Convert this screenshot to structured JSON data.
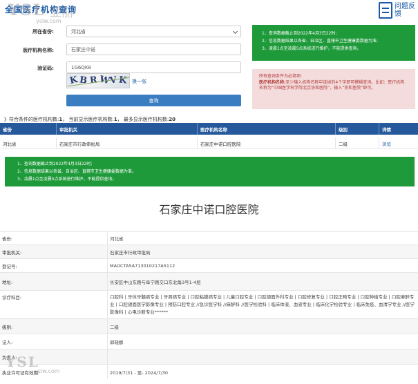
{
  "header": {
    "site_title": "全国医疗机构查询",
    "feedback_label": "问题反馈",
    "watermark_logo": "YSL",
    "watermark_cn": "亚丽",
    "watermark_url": "yslw.com"
  },
  "form": {
    "province_label": "所在省份:",
    "province_value": "河北省",
    "org_label": "医疗机构名称:",
    "org_value": "石家庄中诺",
    "captcha_label": "验证码:",
    "captcha_value": "1G6QK8",
    "captcha_chars": [
      "K",
      "B",
      "R",
      "W",
      "V",
      "K"
    ],
    "refresh_link": "换一张",
    "query_button": "查询"
  },
  "notice_top": {
    "lines": [
      "1、查询数据截止到2022年4月3日22时;",
      "2、信息数据结果以各省、自治区、直辖市卫生健康委数据为准;",
      "3、凌晨1点至凌晨5点系统进行维护，不能提供查询。"
    ]
  },
  "notice_red": {
    "line1": "所有查询条件为必填项:",
    "line2_label": "医疗机构名称:",
    "line2_text": "至少输入机构名称中连续的4个字即可模糊查询。比如：医疗机构名称为“中国医学科学院北京协和医院”，输入“协和医院”即可。"
  },
  "summary": {
    "prefix": "》符合条件的医疗机构数:",
    "match_count": "1",
    "current_label": "， 当前显示医疗机构数:",
    "current_count": "1",
    "max_label": "， 最多显示医疗机构数:",
    "max_count": "20"
  },
  "table": {
    "headers": [
      "省份",
      "审批机关",
      "医疗机构名称",
      "级别",
      "详情"
    ],
    "rows": [
      {
        "province": "河北省",
        "authority": "石家庄市行政审批局",
        "name": "石家庄中诺口腔医院",
        "level": "二级",
        "detail": "浏览"
      }
    ]
  },
  "notice_bottom": {
    "lines": [
      "1、查询数据截止到2022年4月3日22时;",
      "2、信息数据结果以各省、自治区、直辖市卫生健康委数据为准。",
      "3、凌晨1点至凌晨5点系统进行维护，不能提供查询。"
    ]
  },
  "detail": {
    "title": "石家庄中诺口腔医院",
    "rows": [
      {
        "label": "省份:",
        "value": "河北省"
      },
      {
        "label": "审批机关:",
        "value": "石家庄市行政审批局"
      },
      {
        "label": "登记号:",
        "value": "MAOCTA5A713010217A5112"
      },
      {
        "label": "地址:",
        "value": "长安区中山东路与阜宁路交口东北角3号1-4层"
      },
      {
        "label": "诊疗科目:",
        "value": "口腔科 | 牙体牙髓病专业 | 牙周病专业 | 口腔粘膜病专业 | 儿童口腔专业 | 口腔颌面外科专业 | 口腔修复专业 | 口腔正畸专业 | 口腔种植专业 | 口腔麻醉专业 | 口腔颌面医学影像专业 | 预防口腔专业 //急诊医学科 //麻醉科 //医学检验科 | 临床体液、血液专业 | 临床化学检验专业 | 临床免疫、血清学专业 //医学影像科 | 心电诊断专业******"
      },
      {
        "label": "级别:",
        "value": "二级"
      },
      {
        "label": "法人:",
        "value": "郭晓娜"
      },
      {
        "label": "负责人:",
        "value": ""
      },
      {
        "label": "执业许可证有效期:",
        "value": "2019/7/31 - 至- 2024/7/30"
      }
    ]
  },
  "colors": {
    "primary": "#26599b",
    "button": "#3a7ec1",
    "notice_green": "#1f9a3a",
    "notice_red_bg": "#f4dcdc",
    "notice_red_text": "#b23b3b",
    "link": "#1a5aa6"
  }
}
